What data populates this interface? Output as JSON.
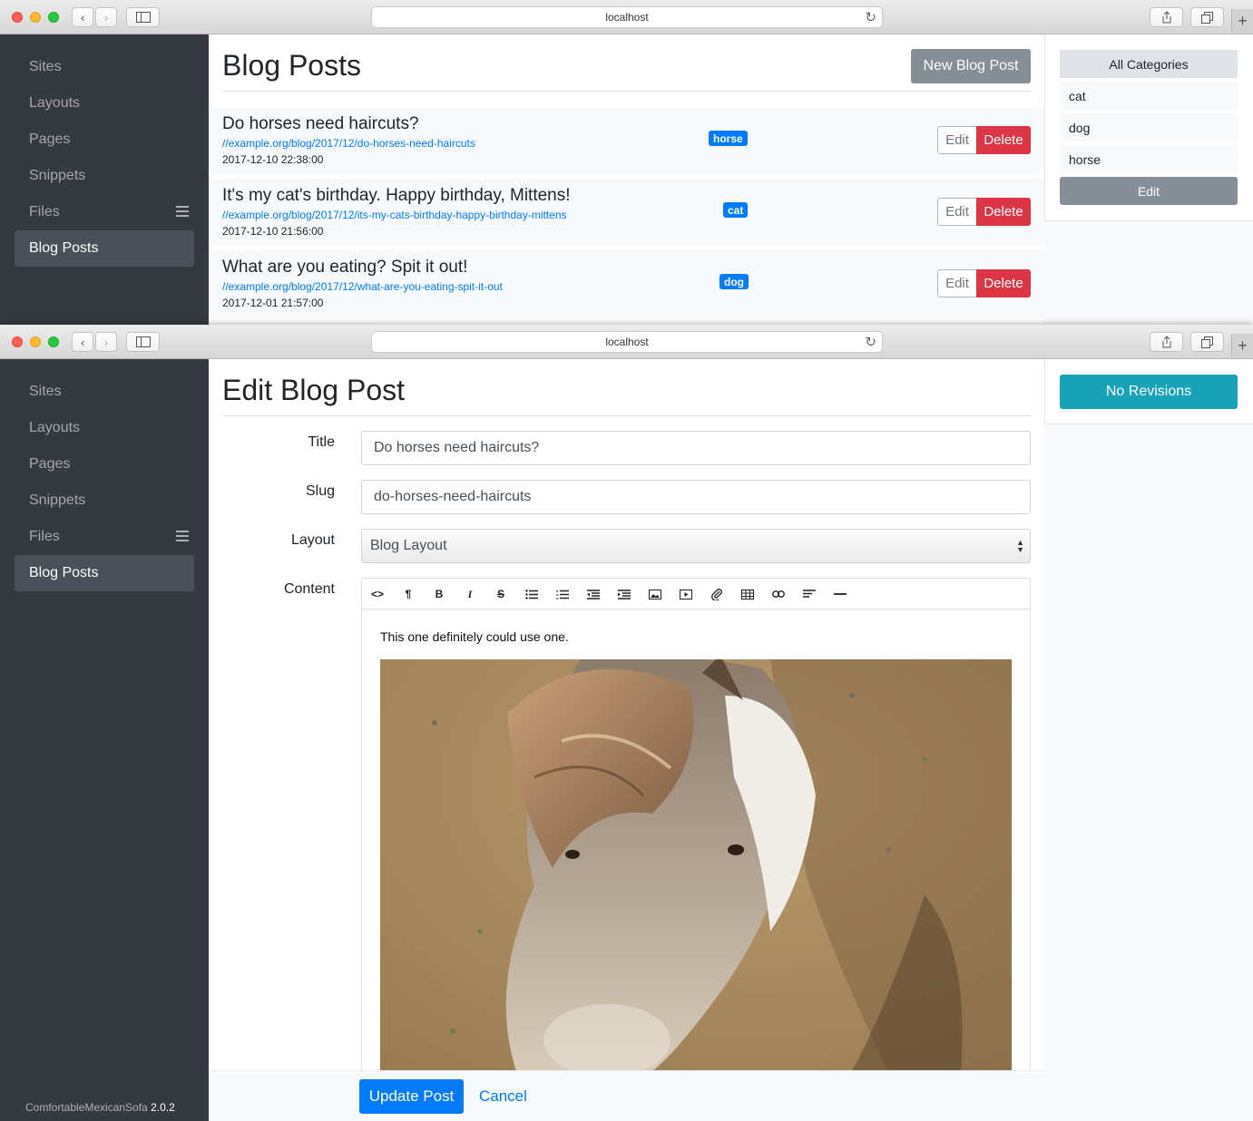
{
  "browser": {
    "url": "localhost"
  },
  "sidebar": {
    "items": [
      {
        "label": "Sites"
      },
      {
        "label": "Layouts"
      },
      {
        "label": "Pages"
      },
      {
        "label": "Snippets"
      },
      {
        "label": "Files"
      },
      {
        "label": "Blog Posts"
      }
    ],
    "active": "Blog Posts",
    "app_name": "ComfortableMexicanSofa",
    "version": "2.0.2"
  },
  "list_view": {
    "title": "Blog Posts",
    "new_button": "New Blog Post",
    "posts": [
      {
        "title": "Do horses need haircuts?",
        "url": "//example.org/blog/2017/12/do-horses-need-haircuts",
        "date": "2017-12-10 22:38:00",
        "category": "horse"
      },
      {
        "title": "It's my cat's birthday. Happy birthday, Mittens!",
        "url": "//example.org/blog/2017/12/its-my-cats-birthday-happy-birthday-mittens",
        "date": "2017-12-10 21:56:00",
        "category": "cat"
      },
      {
        "title": "What are you eating? Spit it out!",
        "url": "//example.org/blog/2017/12/what-are-you-eating-spit-it-out",
        "date": "2017-12-01 21:57:00",
        "category": "dog"
      }
    ],
    "edit_label": "Edit",
    "delete_label": "Delete",
    "categories": {
      "header": "All Categories",
      "items": [
        "cat",
        "dog",
        "horse"
      ],
      "edit_button": "Edit"
    }
  },
  "edit_view": {
    "title": "Edit Blog Post",
    "fields": {
      "title_label": "Title",
      "title_value": "Do horses need haircuts?",
      "slug_label": "Slug",
      "slug_value": "do-horses-need-haircuts",
      "layout_label": "Layout",
      "layout_value": "Blog Layout",
      "content_label": "Content"
    },
    "toolbar_icons": [
      "code-icon",
      "paragraph-icon",
      "bold-icon",
      "italic-icon",
      "strikethrough-icon",
      "unordered-list-icon",
      "ordered-list-icon",
      "outdent-icon",
      "indent-icon",
      "image-icon",
      "video-icon",
      "file-link-icon",
      "table-icon",
      "link-icon",
      "align-icon",
      "horizontal-rule-icon"
    ],
    "content_text": "This one definitely could use one.",
    "revisions_button": "No Revisions",
    "submit_button": "Update Post",
    "cancel_link": "Cancel"
  },
  "colors": {
    "primary": "#007bff",
    "danger": "#dc3545",
    "info": "#17a2b8",
    "secondary": "#868e96",
    "sidebar": "#343a40"
  }
}
